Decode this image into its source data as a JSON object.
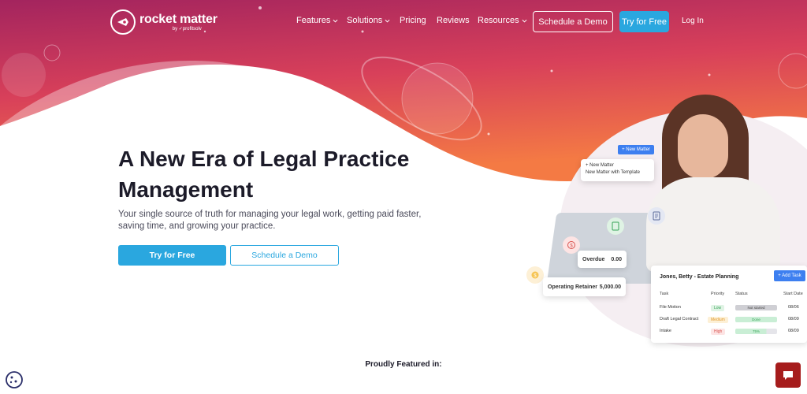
{
  "nav": {
    "logo_text": "rocket matter",
    "logo_sub": "by ✓profitsolv",
    "items": [
      {
        "label": "Features"
      },
      {
        "label": "Solutions"
      },
      {
        "label": "Pricing"
      },
      {
        "label": "Reviews"
      },
      {
        "label": "Resources"
      }
    ],
    "demo_button": "Schedule a Demo",
    "free_button": "Try for Free",
    "login": "Log In"
  },
  "hero": {
    "title": "A New Era of Legal Practice Management",
    "subtitle": "Your single source of truth for managing your legal work, getting paid faster, saving time, and growing your practice.",
    "primary_cta": "Try for Free",
    "secondary_cta": "Schedule a Demo"
  },
  "illustration": {
    "new_matter_button": "+ New Matter",
    "menu_items": [
      "+ New Matter",
      "New Matter with Template"
    ],
    "overdue_label": "Overdue",
    "overdue_value": "0.00",
    "retainer_label": "Operating Retainer",
    "retainer_value": "5,000.00",
    "task_card_title": "Jones, Betty - Estate Planning",
    "add_task_button": "+ Add Task",
    "task_headers": [
      "Task",
      "Priority",
      "Status",
      "Start Date"
    ],
    "tasks": [
      {
        "task": "File Motion",
        "priority": "Low",
        "status": "Not started",
        "date": "08/06"
      },
      {
        "task": "Draft Legal Contract",
        "priority": "Medium",
        "status": "Done",
        "date": "08/09"
      },
      {
        "task": "Intake",
        "priority": "High",
        "status": "75%",
        "date": "08/09"
      }
    ]
  },
  "featured": "Proudly Featured in:",
  "colors": {
    "accent": "#2aa7df",
    "hero_gradient_top": "#b3275f",
    "hero_gradient_bottom": "#ef6a48",
    "chat": "#a61c1c"
  }
}
